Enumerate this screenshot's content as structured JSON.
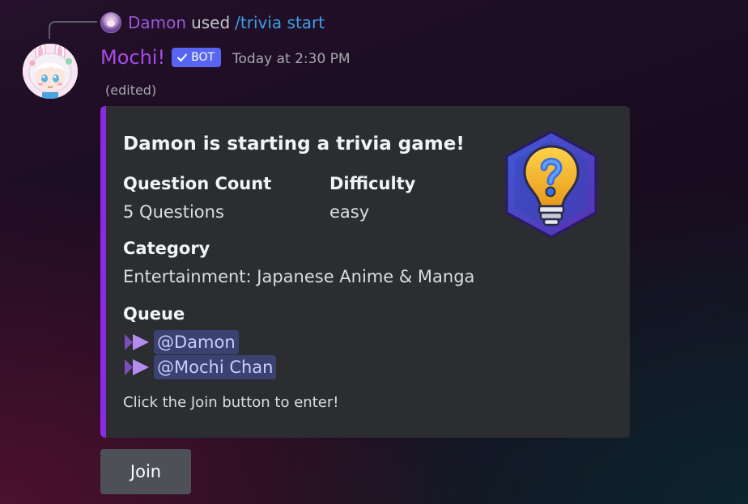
{
  "reply": {
    "user": "Damon",
    "used_text": "used",
    "command": "/trivia start"
  },
  "message": {
    "author": "Mochi!",
    "bot_tag": "BOT",
    "timestamp": "Today at 2:30 PM",
    "edited": "(edited)"
  },
  "embed": {
    "accent_color": "#8a2be2",
    "title": "Damon is starting a trivia game!",
    "fields": {
      "question_count": {
        "name": "Question Count",
        "value": "5 Questions"
      },
      "difficulty": {
        "name": "Difficulty",
        "value": "easy"
      },
      "category": {
        "name": "Category",
        "value": "Entertainment: Japanese Anime & Manga"
      },
      "queue": {
        "name": "Queue",
        "members": [
          "@Damon",
          "@Mochi Chan"
        ]
      }
    },
    "footer_text": "Click the Join button to enter!",
    "thumbnail_icon": "trivia-lightbulb-question-icon"
  },
  "buttons": {
    "join_label": "Join"
  }
}
